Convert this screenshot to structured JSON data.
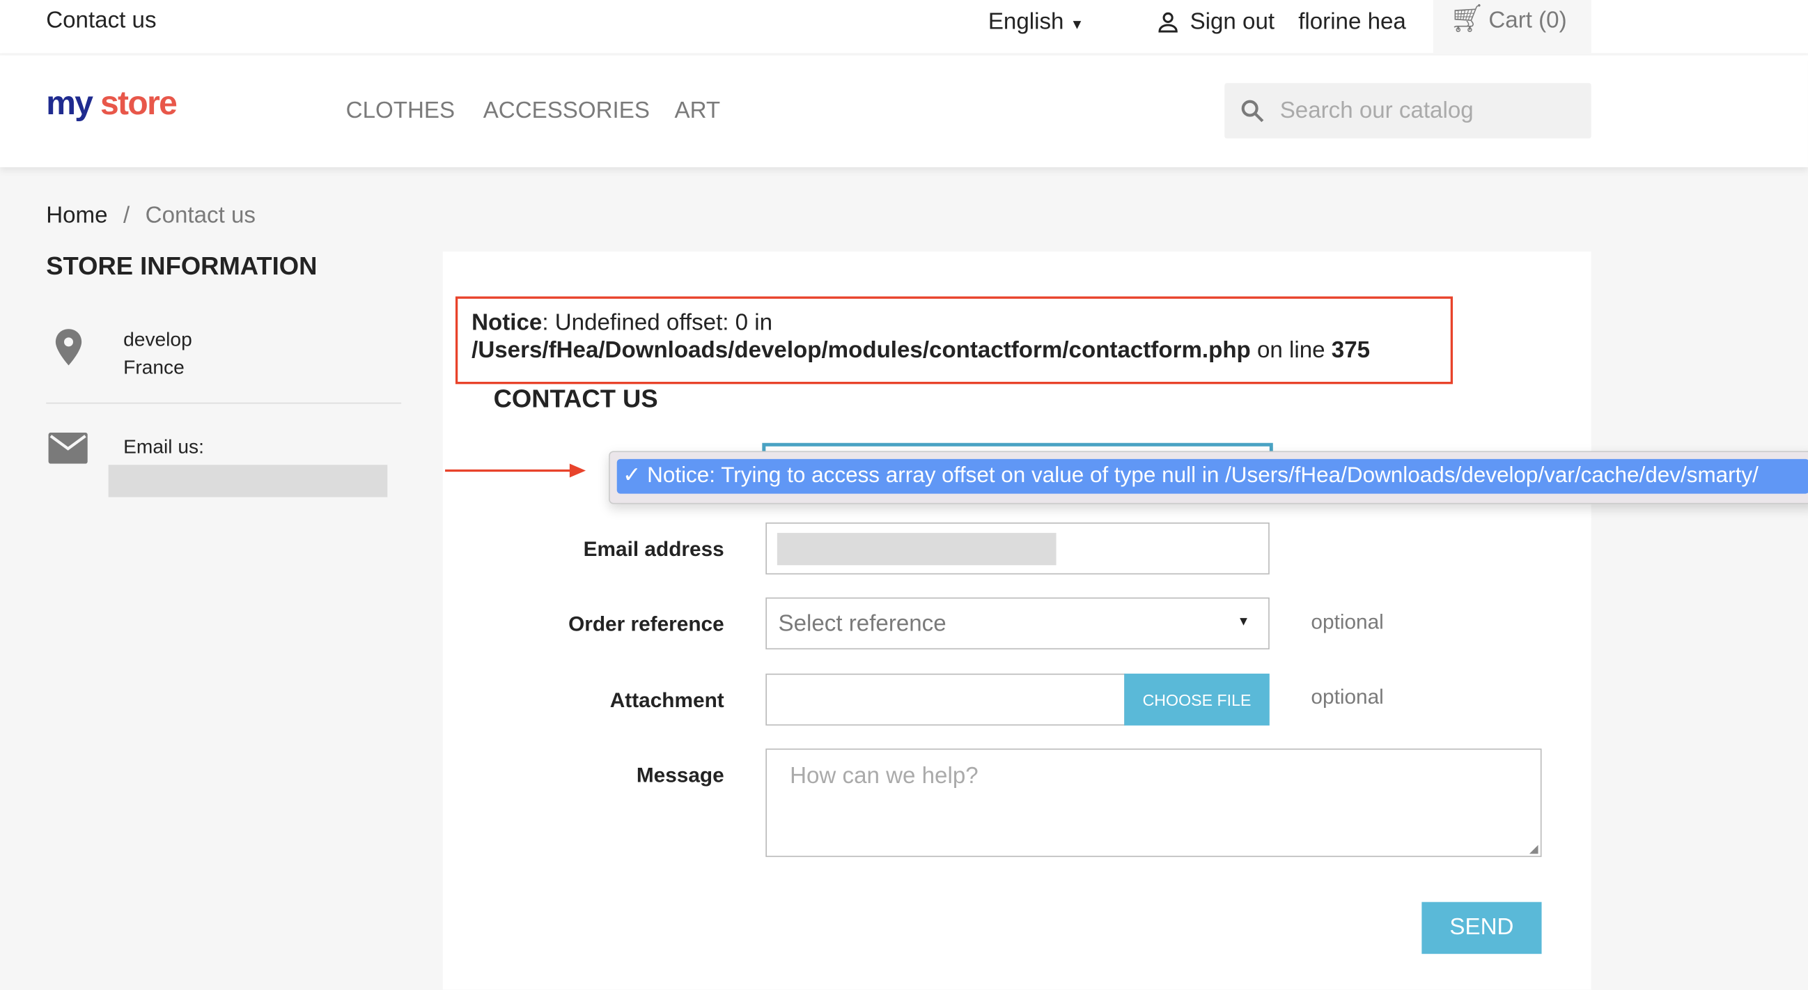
{
  "topbar": {
    "contact": "Contact us",
    "language": "English",
    "sign_out": "Sign out",
    "user": "florine hea",
    "cart": "Cart (0)"
  },
  "header": {
    "logo": "my store",
    "nav": [
      "CLOTHES",
      "ACCESSORIES",
      "ART"
    ],
    "search_placeholder": "Search our catalog"
  },
  "breadcrumb": {
    "home": "Home",
    "sep": "/",
    "current": "Contact us"
  },
  "store": {
    "title": "STORE INFORMATION",
    "line1": "develop",
    "line2": "France",
    "email_label": "Email us:"
  },
  "notice": {
    "bold": "Notice",
    "text": ": Undefined offset: 0 in",
    "path": "/Users/fHea/Downloads/develop/modules/contactform/contactform.php",
    "on_line": " on line ",
    "line": "375"
  },
  "form": {
    "title": "CONTACT US",
    "tooltip": "✓ Notice: Trying to access array offset on value of type null in /Users/fHea/Downloads/develop/var/cache/dev/smarty/",
    "email_label": "Email address",
    "order_label": "Order reference",
    "order_value": "Select reference",
    "optional": "optional",
    "attachment_label": "Attachment",
    "choose_file": "CHOOSE FILE",
    "message_label": "Message",
    "message_placeholder": "How can we help?",
    "send": "SEND"
  },
  "colors": {
    "accent": "#5ab9d8",
    "notice_border": "#e8432b",
    "tooltip_highlight": "#6097f5"
  }
}
